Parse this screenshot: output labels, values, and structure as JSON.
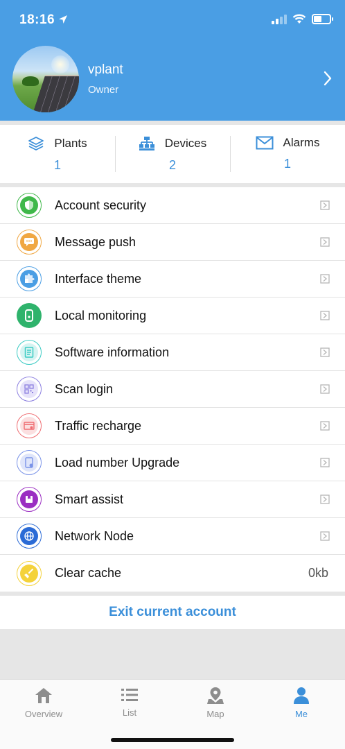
{
  "status_bar": {
    "time": "18:16"
  },
  "profile": {
    "name": "vplant",
    "role": "Owner"
  },
  "stats": [
    {
      "label": "Plants",
      "count": "1",
      "icon": "layers-icon"
    },
    {
      "label": "Devices",
      "count": "2",
      "icon": "network-icon"
    },
    {
      "label": "Alarms",
      "count": "1",
      "icon": "envelope-icon"
    }
  ],
  "menu": {
    "items": [
      {
        "label": "Account security",
        "icon": "shield-icon",
        "color": "#3fb84a"
      },
      {
        "label": "Message push",
        "icon": "chat-icon",
        "color": "#f0a742"
      },
      {
        "label": "Interface theme",
        "icon": "puzzle-icon",
        "color": "#4a9ee4"
      },
      {
        "label": "Local monitoring",
        "icon": "remote-icon",
        "color": "#2fb36c"
      },
      {
        "label": "Software information",
        "icon": "document-icon",
        "color": "#3ccbc4"
      },
      {
        "label": "Scan login",
        "icon": "qr-code-icon",
        "color": "#8c7fe0"
      },
      {
        "label": "Traffic recharge",
        "icon": "card-icon",
        "color": "#ef6d72"
      },
      {
        "label": "Load number Upgrade",
        "icon": "upgrade-icon",
        "color": "#7a93e8"
      },
      {
        "label": "Smart assist",
        "icon": "bookmark-icon",
        "color": "#9b2ec2"
      },
      {
        "label": "Network Node",
        "icon": "globe-icon",
        "color": "#2b6bd6"
      },
      {
        "label": "Clear cache",
        "icon": "broom-icon",
        "color": "#f4d23a",
        "value": "0kb"
      }
    ]
  },
  "exit": {
    "label": "Exit current account"
  },
  "nav": [
    {
      "label": "Overview",
      "icon": "home-icon"
    },
    {
      "label": "List",
      "icon": "list-icon"
    },
    {
      "label": "Map",
      "icon": "map-pin-icon"
    },
    {
      "label": "Me",
      "icon": "person-icon",
      "active": true
    }
  ]
}
